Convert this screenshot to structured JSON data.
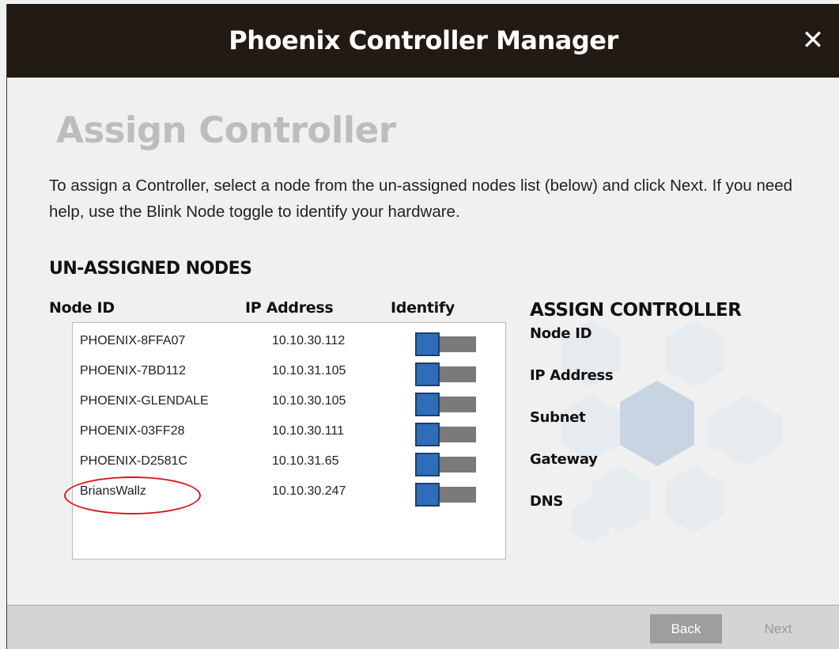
{
  "window": {
    "title": "Phoenix Controller Manager",
    "close_glyph": "✕"
  },
  "page": {
    "heading": "Assign Controller",
    "instructions": "To assign a Controller, select a node from the un-assigned nodes list (below) and click Next.  If you need help, use the Blink Node toggle to identify your hardware."
  },
  "unassigned": {
    "section_title": "UN-ASSIGNED NODES",
    "columns": {
      "node_id": "Node ID",
      "ip_address": "IP Address",
      "identify": "Identify"
    },
    "nodes": [
      {
        "id": "PHOENIX-8FFA07",
        "ip": "10.10.30.112",
        "identify_on": false
      },
      {
        "id": "PHOENIX-7BD112",
        "ip": "10.10.31.105",
        "identify_on": false
      },
      {
        "id": "PHOENIX-GLENDALE",
        "ip": "10.10.30.105",
        "identify_on": false
      },
      {
        "id": "PHOENIX-03FF28",
        "ip": "10.10.30.111",
        "identify_on": false
      },
      {
        "id": "PHOENIX-D2581C",
        "ip": "10.10.31.65",
        "identify_on": false
      },
      {
        "id": "BriansWallz",
        "ip": "10.10.30.247",
        "identify_on": false,
        "highlighted": true
      }
    ]
  },
  "assign": {
    "title": "ASSIGN CONTROLLER",
    "labels": {
      "node_id": "Node ID",
      "ip_address": "IP Address",
      "subnet": "Subnet",
      "gateway": "Gateway",
      "dns": "DNS"
    }
  },
  "footer": {
    "back_label": "Back",
    "next_label": "Next"
  },
  "colors": {
    "titlebar_bg": "#221b14",
    "toggle_knob": "#2e6db8",
    "toggle_track": "#7a7a7a",
    "highlight_circle": "#e0141b",
    "hex_light": "#dfe6ee",
    "hex_dark": "#c3d2e2",
    "back_button": "#9e9e9e"
  }
}
